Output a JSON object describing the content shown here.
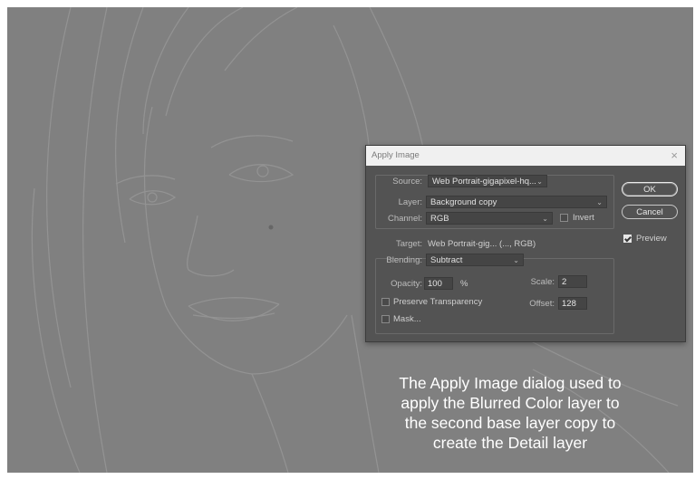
{
  "dialog": {
    "title": "Apply Image",
    "close_glyph": "×",
    "source_label": "Source:",
    "source_value": "Web Portrait-gigapixel-hq...",
    "layer_label": "Layer:",
    "layer_value": "Background copy",
    "channel_label": "Channel:",
    "channel_value": "RGB",
    "invert_label": "Invert",
    "invert_checked": false,
    "target_label": "Target:",
    "target_value": "Web Portrait-gig... (..., RGB)",
    "blending_label": "Blending:",
    "blending_value": "Subtract",
    "opacity_label": "Opacity:",
    "opacity_value": "100",
    "opacity_unit": "%",
    "scale_label": "Scale:",
    "scale_value": "2",
    "offset_label": "Offset:",
    "offset_value": "128",
    "preserve_transparency_label": "Preserve Transparency",
    "preserve_transparency_checked": false,
    "mask_label": "Mask...",
    "mask_checked": false,
    "ok_label": "OK",
    "cancel_label": "Cancel",
    "preview_label": "Preview",
    "preview_checked": true
  },
  "caption": {
    "lines": [
      "The Apply Image dialog used to",
      "apply the Blurred Color layer to",
      "the second base layer copy to",
      "create the Detail layer"
    ]
  },
  "colors": {
    "canvas_gray": "#808080",
    "dialog_bg": "#535353",
    "titlebar_bg": "#f0f0f0"
  }
}
